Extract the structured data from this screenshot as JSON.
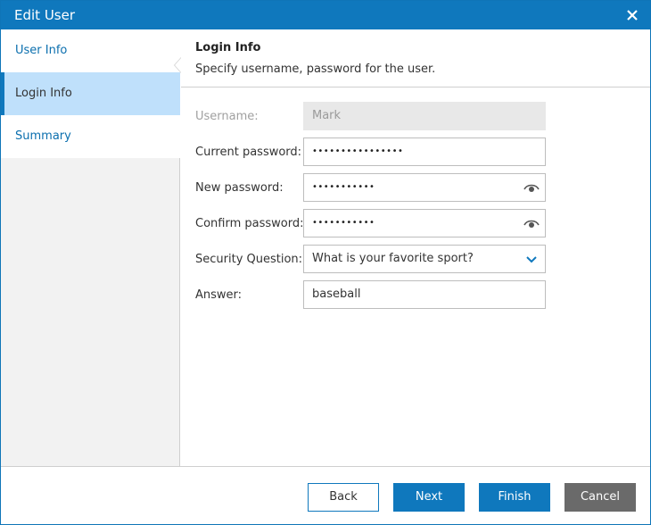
{
  "window": {
    "title": "Edit User",
    "close_icon": "close-icon"
  },
  "sidebar": {
    "items": [
      {
        "label": "User Info",
        "active": false
      },
      {
        "label": "Login Info",
        "active": true
      },
      {
        "label": "Summary",
        "active": false
      }
    ]
  },
  "main": {
    "title": "Login Info",
    "subtitle": "Specify username, password for the user.",
    "fields": {
      "username": {
        "label": "Username:",
        "value": "Mark",
        "disabled": true
      },
      "current_password": {
        "label": "Current password:",
        "masked": "••••••••••••••••"
      },
      "new_password": {
        "label": "New password:",
        "masked": "•••••••••••",
        "icon": "eye-icon"
      },
      "confirm_password": {
        "label": "Confirm password:",
        "masked": "•••••••••••",
        "icon": "eye-icon"
      },
      "security_question": {
        "label": "Security Question:",
        "value": "What is your favorite sport?",
        "icon": "chevron-down-icon"
      },
      "answer": {
        "label": "Answer:",
        "value": "baseball"
      }
    }
  },
  "footer": {
    "back_label": "Back",
    "next_label": "Next",
    "finish_label": "Finish",
    "cancel_label": "Cancel"
  },
  "colors": {
    "accent": "#0f78bd",
    "nav_active_bg": "#bfe0fb",
    "cancel_bg": "#6a6a6a",
    "readonly_bg": "#e8e8e8"
  }
}
